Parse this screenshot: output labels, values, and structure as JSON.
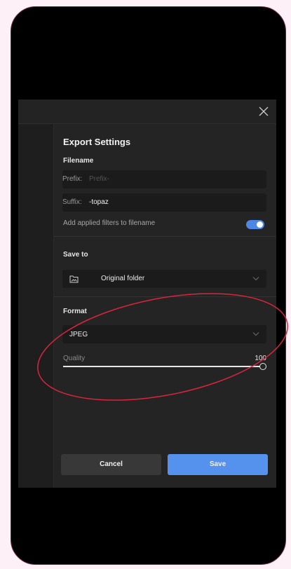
{
  "dialog": {
    "title": "Export Settings",
    "filename_label": "Filename",
    "prefix": {
      "label": "Prefix:",
      "placeholder": "Prefix-",
      "value": ""
    },
    "suffix": {
      "label": "Suffix:",
      "value": "-topaz"
    },
    "add_filters_label": "Add applied filters to filename",
    "add_filters_enabled": true,
    "save_to_label": "Save to",
    "save_to_value": "Original folder",
    "format_label": "Format",
    "format_value": "JPEG",
    "quality_label": "Quality",
    "quality_value": "100",
    "quality_level_percent": 100,
    "cancel_label": "Cancel",
    "save_label": "Save"
  },
  "icons": {
    "close": "close-icon",
    "folder": "folder-image-icon",
    "chevron": "chevron-down-icon"
  },
  "colors": {
    "accent": "#5592ee",
    "toggle_on": "#4e86e6",
    "annotation": "#d9253f"
  }
}
